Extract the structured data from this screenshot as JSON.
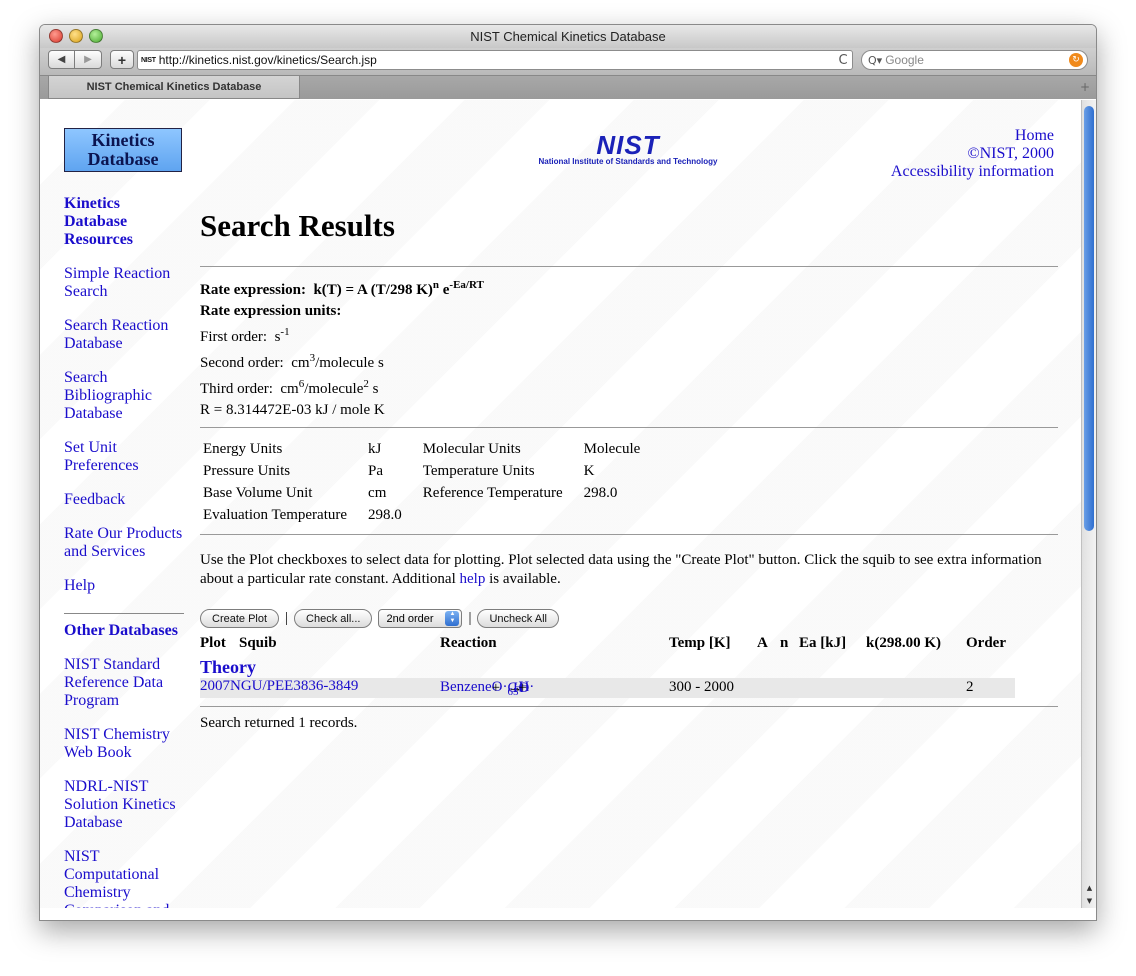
{
  "browser": {
    "window_title": "NIST Chemical Kinetics Database",
    "favicon_text": "NIST",
    "url": "http://kinetics.nist.gov/kinetics/Search.jsp",
    "search_placeholder": "Google",
    "tab_label": "NIST Chemical Kinetics Database",
    "icons": {
      "back": "◀",
      "forward": "▶",
      "add": "+",
      "reload": "C",
      "search": "Q▾",
      "go": "↻",
      "new_tab": "+"
    }
  },
  "header": {
    "logo_line1": "Kinetics",
    "logo_line2": "Database",
    "nist_word": "NIST",
    "nist_sub": "National Institute of Standards and Technology",
    "links": [
      "Home",
      "©NIST, 2000",
      "Accessibility information"
    ]
  },
  "sidebar": {
    "heading": "Kinetics Database Resources",
    "items": [
      "Simple Reaction Search",
      "Search Reaction Database",
      "Search Bibliographic Database",
      "Set Unit Preferences",
      "Feedback",
      "Rate Our Products and Services",
      "Help"
    ],
    "heading2": "Other Databases",
    "items2": [
      "NIST Standard Reference Data Program",
      "NIST Chemistry Web Book",
      "NDRL-NIST Solution Kinetics Database",
      "NIST Computational Chemistry Comparison and"
    ]
  },
  "main": {
    "title": "Search Results",
    "rate_expression_label": "Rate expression:",
    "rate_expression_formula_a": "k(T) = A (T/298 K)",
    "rate_expression_sup_n": "n",
    "rate_expression_e": " e",
    "rate_expression_sup_exp": "-Ea/RT",
    "units_label": "Rate expression units:",
    "first_order": "First order:",
    "first_order_unit": "s",
    "first_order_sup": "-1",
    "second_order": "Second order:",
    "second_order_unit_a": "cm",
    "second_order_sup": "3",
    "second_order_unit_b": "/molecule s",
    "third_order": "Third order:",
    "third_order_unit_a": "cm",
    "third_order_sup1": "6",
    "third_order_unit_b": "/molecule",
    "third_order_sup2": "2",
    "third_order_unit_c": " s",
    "r_constant": "R = 8.314472E-03 kJ / mole K",
    "units_table": [
      [
        "Energy Units",
        "kJ",
        "Molecular Units",
        "Molecule"
      ],
      [
        "Pressure Units",
        "Pa",
        "Temperature Units",
        "K"
      ],
      [
        "Base Volume Unit",
        "cm",
        "Reference Temperature",
        "298.0"
      ],
      [
        "Evaluation Temperature",
        "298.0",
        "",
        ""
      ]
    ],
    "intro_a": "Use the Plot checkboxes to select data for plotting. Plot selected data using the \"Create Plot\" button. Click the squib to see extra information about a particular rate constant. Additional ",
    "intro_link": "help",
    "intro_b": " is available.",
    "buttons": {
      "create_plot": "Create Plot",
      "check_all": "Check all...",
      "order_select": "2nd order",
      "uncheck_all": "Uncheck All",
      "separator": "|"
    },
    "columns": [
      "Plot",
      "Squib",
      "Reaction",
      "Temp [K]",
      "A",
      "n",
      "Ea [kJ]",
      "k(298.00 K)",
      "Order"
    ],
    "group_label": "Theory",
    "row": {
      "squib": "2007NGU/PEE3836-3849",
      "reactant1": "Benzene",
      "plus1": " + ",
      "reactant2": "O·",
      "arrow": " → ",
      "product1_a": "C",
      "product1_sub1": "6",
      "product1_b": "H",
      "product1_sub2": "5",
      "product1_c": "O",
      "plus2": " + ",
      "product2": "H·",
      "temp": "300 - 2000",
      "order": "2"
    },
    "footer_text": "Search returned 1 records."
  }
}
